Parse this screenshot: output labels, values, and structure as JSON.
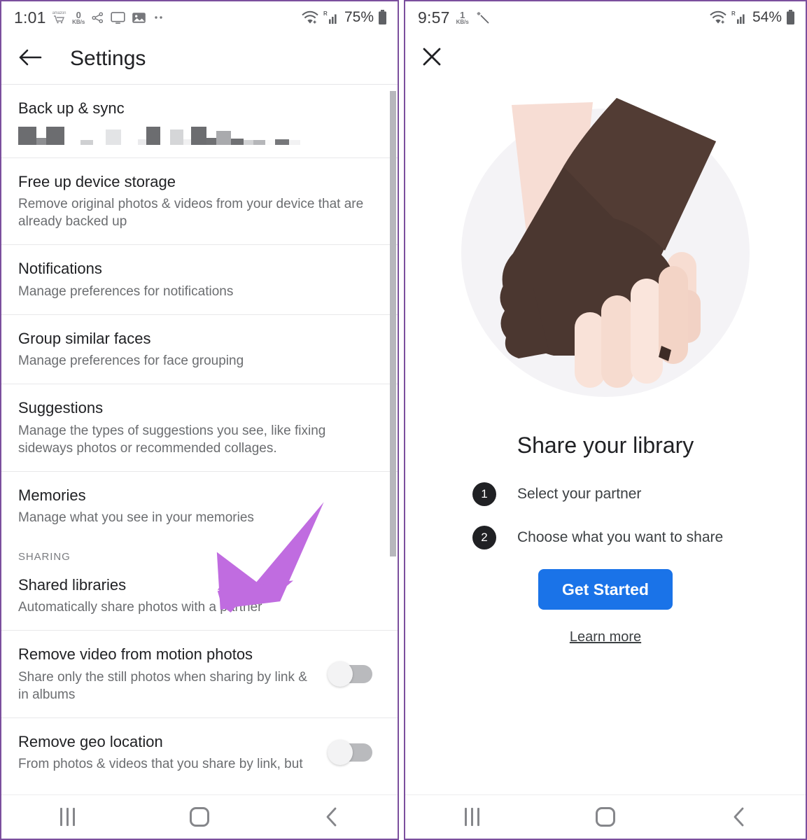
{
  "left_phone": {
    "status_bar": {
      "time": "1:01",
      "data_speed_value": "0",
      "data_speed_unit": "KB/s",
      "amazon_label": "amazon",
      "battery_percent": "75%",
      "roaming_label": "R",
      "icons": [
        "amazon-cart-icon",
        "data-speed-icon",
        "bluetooth-share-icon",
        "cast-monitor-icon",
        "photo-icon",
        "overflow-dots-icon",
        "wifi-icon",
        "cellular-signal-icon",
        "battery-icon"
      ]
    },
    "app_bar": {
      "back_label": "←",
      "title": "Settings"
    },
    "rows": [
      {
        "title": "Back up & sync",
        "subtitle": "",
        "pixelated": true,
        "toggle": null
      },
      {
        "title": "Free up device storage",
        "subtitle": "Remove original photos & videos from your device that are already backed up",
        "toggle": null
      },
      {
        "title": "Notifications",
        "subtitle": "Manage preferences for notifications",
        "toggle": null
      },
      {
        "title": "Group similar faces",
        "subtitle": "Manage preferences for face grouping",
        "toggle": null
      },
      {
        "title": "Suggestions",
        "subtitle": "Manage the types of suggestions you see, like fixing sideways photos or recommended collages.",
        "toggle": null
      },
      {
        "title": "Memories",
        "subtitle": "Manage what you see in your memories",
        "toggle": null
      }
    ],
    "section_label": "SHARING",
    "shared_row": {
      "title": "Shared libraries",
      "subtitle": "Automatically share photos with a partner"
    },
    "toggle_rows": [
      {
        "title": "Remove video from motion photos",
        "subtitle": "Share only the still photos when sharing by link & in albums",
        "toggle": "off"
      },
      {
        "title": "Remove geo location",
        "subtitle": "From photos & videos that you share by link, but",
        "toggle": "off"
      }
    ],
    "annotation": {
      "shape": "arrow",
      "color": "#c06ce0",
      "points_at": "Shared libraries"
    },
    "nav_bar": {
      "recents": "recents-button",
      "home": "home-button",
      "back": "back-button"
    }
  },
  "right_phone": {
    "status_bar": {
      "time": "9:57",
      "data_speed_value": "1",
      "data_speed_unit": "KB/s",
      "battery_percent": "54%",
      "roaming_label": "R",
      "icons": [
        "data-speed-icon",
        "sparkle-wand-icon",
        "wifi-icon",
        "cellular-signal-icon",
        "battery-icon"
      ]
    },
    "app_bar": {
      "close_label": "✕"
    },
    "illustration": {
      "name": "holding-hands-illustration",
      "circle_color": "#f3f2f5",
      "dark_hand_color": "#4a3631",
      "light_hand_color": "#f6ddd5"
    },
    "headline": "Share your library",
    "steps": [
      {
        "number": "1",
        "label": "Select your partner"
      },
      {
        "number": "2",
        "label": "Choose what you want to share"
      }
    ],
    "primary_button": {
      "label": "Get Started",
      "color": "#1a73e8"
    },
    "secondary_link": {
      "label": "Learn more"
    },
    "nav_bar": {
      "recents": "recents-button",
      "home": "home-button",
      "back": "back-button"
    }
  }
}
